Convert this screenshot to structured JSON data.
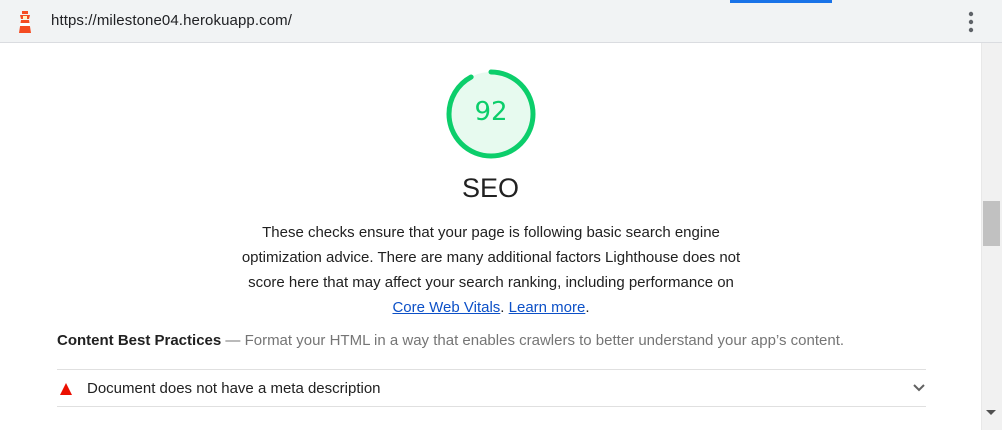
{
  "address_bar": {
    "url": "https://milestone04.herokuapp.com/"
  },
  "category": {
    "score": "92",
    "score_fraction": 0.92,
    "score_color": "#0cce6b",
    "title": "SEO",
    "description": "These checks ensure that your page is following basic search engine optimization advice. There are many additional factors Lighthouse does not score here that may affect your search ranking, including performance on",
    "link_cwv": "Core Web Vitals",
    "link_separator": ".",
    "link_learn": "Learn more",
    "link_end": "."
  },
  "group": {
    "title": "Content Best Practices",
    "separator": "—",
    "description": "Format your HTML in a way that enables crawlers to better understand your app’s content."
  },
  "audits": [
    {
      "title": "Document does not have a meta description",
      "status_icon": "fail-triangle-icon",
      "status_color": "#eb0f00"
    }
  ],
  "icons": {
    "logo": "lighthouse-icon",
    "menu": "more-vert-icon",
    "expand": "chevron-down-icon"
  }
}
